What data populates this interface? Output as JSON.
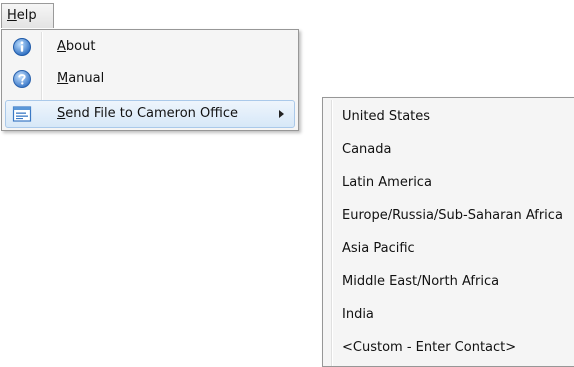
{
  "menubar": {
    "help": {
      "mnemonic": "H",
      "rest": "elp"
    }
  },
  "help_menu": {
    "items": [
      {
        "mnemonic": "A",
        "rest": "bout",
        "icon": "info-icon"
      },
      {
        "mnemonic": "M",
        "rest": "anual",
        "icon": "help-icon"
      },
      {
        "mnemonic": "S",
        "rest": "end File to Cameron Office",
        "icon": "send-file-icon",
        "has_submenu": true
      }
    ]
  },
  "submenu": {
    "items": [
      "United States",
      "Canada",
      "Latin America",
      "Europe/Russia/Sub-Saharan Africa",
      "Asia Pacific",
      "Middle East/North Africa",
      "India",
      "<Custom - Enter Contact>"
    ]
  },
  "colors": {
    "highlight": "#d7e8f8",
    "menu_background": "#f5f5f5"
  }
}
